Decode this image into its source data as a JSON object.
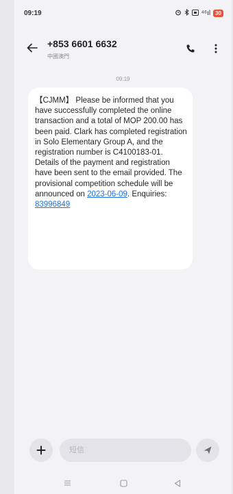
{
  "status_bar": {
    "time": "09:19",
    "signal_text": "⁴⁶ıl",
    "battery_text": "30"
  },
  "header": {
    "contact_number": "+853 6601 6632",
    "contact_region": "中國澳門"
  },
  "thread": {
    "timestamp": "09:19",
    "message": {
      "text": "【CJMM】 Please be informed that you have successfully completed the online transaction and a total of MOP 200.00 has been paid. Clark has completed registration in Solo Elementary Group A, and the registration number is C4100183-01. Details of the payment and registration have been sent to the email provided. The provisional competition schedule will be announced on ",
      "date_link": "2023-06-09",
      "text_after_date": ". Enquiries: ",
      "phone_link": "83996849"
    }
  },
  "composer": {
    "placeholder": "短信"
  },
  "colors": {
    "link": "#1f6fe0",
    "battery": "#e5533c",
    "bubble": "#ffffff",
    "background": "#f3f3f6"
  },
  "icons": {
    "back": "arrow-left-icon",
    "call": "phone-icon",
    "more": "more-vertical-icon",
    "add": "plus-icon",
    "send": "send-icon",
    "nav_menu": "menu-icon",
    "nav_home": "home-icon",
    "nav_back": "triangle-back-icon"
  }
}
